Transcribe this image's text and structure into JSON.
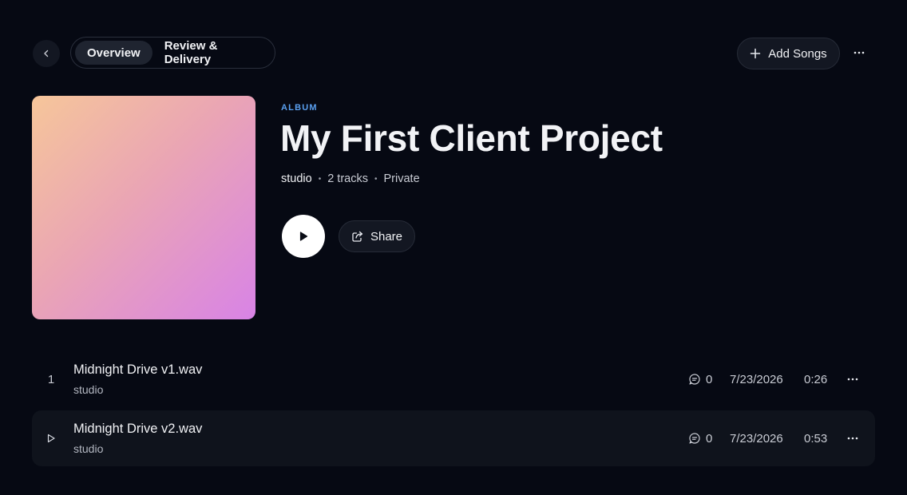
{
  "nav": {
    "back_icon": "chevron-left-icon",
    "tabs": [
      {
        "label": "Overview",
        "active": true
      },
      {
        "label": "Review & Delivery",
        "active": false
      }
    ],
    "add_songs_label": "Add Songs",
    "add_icon": "plus-icon",
    "more_icon": "ellipsis-icon"
  },
  "album": {
    "type_label": "ALBUM",
    "title": "My First Client Project",
    "owner": "studio",
    "track_count": "2 tracks",
    "visibility": "Private",
    "cover_colors": [
      "#f6c69a",
      "#eaa5b4",
      "#d883e6"
    ],
    "play_icon": "play-icon",
    "share_label": "Share",
    "share_icon": "share-icon"
  },
  "tracks": [
    {
      "number": "1",
      "title": "Midnight Drive v1.wav",
      "artist": "studio",
      "comments": "0",
      "date": "7/23/2026",
      "duration": "0:26"
    },
    {
      "number": "",
      "title": "Midnight Drive v2.wav",
      "artist": "studio",
      "comments": "0",
      "date": "7/23/2026",
      "duration": "0:53"
    }
  ],
  "colors": {
    "background": "#060913",
    "accent": "#5aa0f0",
    "surface": "#131722"
  }
}
